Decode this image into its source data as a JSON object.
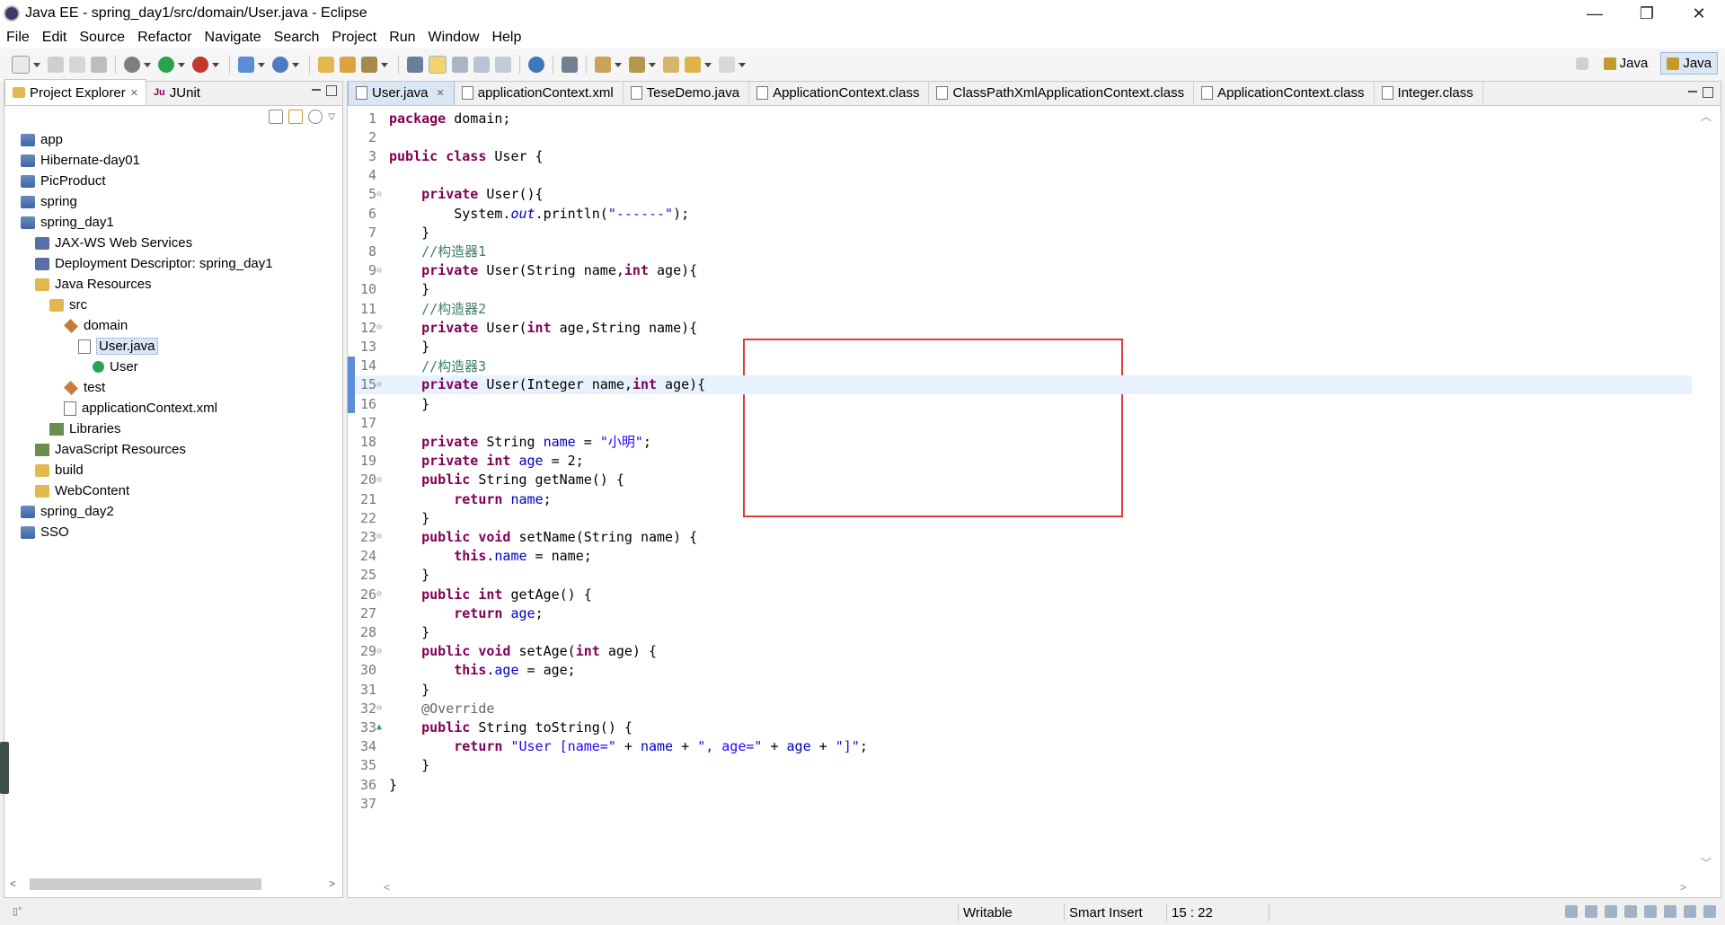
{
  "window": {
    "title": "Java EE - spring_day1/src/domain/User.java - Eclipse",
    "controls": [
      "—",
      "❐",
      "✕"
    ]
  },
  "menu": [
    "File",
    "Edit",
    "Source",
    "Refactor",
    "Navigate",
    "Search",
    "Project",
    "Run",
    "Window",
    "Help"
  ],
  "perspectives": [
    {
      "label": "Java",
      "active": false
    },
    {
      "label": "Java",
      "active": true
    }
  ],
  "project_explorer": {
    "tabs": [
      {
        "label": "Project Explorer",
        "active": true,
        "closable": true
      },
      {
        "label": "JUnit",
        "active": false,
        "closable": false
      }
    ],
    "tree": [
      {
        "label": "app",
        "indent": 0,
        "icon": "project-icon"
      },
      {
        "label": "Hibernate-day01",
        "indent": 0,
        "icon": "project-icon"
      },
      {
        "label": "PicProduct",
        "indent": 0,
        "icon": "project-icon"
      },
      {
        "label": "spring",
        "indent": 0,
        "icon": "project-icon"
      },
      {
        "label": "spring_day1",
        "indent": 0,
        "icon": "project-icon"
      },
      {
        "label": "JAX-WS Web Services",
        "indent": 1,
        "icon": "web-services-icon"
      },
      {
        "label": "Deployment Descriptor: spring_day1",
        "indent": 1,
        "icon": "descriptor-icon"
      },
      {
        "label": "Java Resources",
        "indent": 1,
        "icon": "java-resources-icon"
      },
      {
        "label": "src",
        "indent": 2,
        "icon": "source-folder-icon"
      },
      {
        "label": "domain",
        "indent": 3,
        "icon": "package-icon"
      },
      {
        "label": "User.java",
        "indent": 4,
        "icon": "java-file-icon",
        "selected": true
      },
      {
        "label": "User",
        "indent": 5,
        "icon": "class-icon"
      },
      {
        "label": "test",
        "indent": 3,
        "icon": "package-icon"
      },
      {
        "label": "applicationContext.xml",
        "indent": 3,
        "icon": "xml-file-icon"
      },
      {
        "label": "Libraries",
        "indent": 2,
        "icon": "libraries-icon"
      },
      {
        "label": "JavaScript Resources",
        "indent": 1,
        "icon": "js-resources-icon"
      },
      {
        "label": "build",
        "indent": 1,
        "icon": "folder-icon"
      },
      {
        "label": "WebContent",
        "indent": 1,
        "icon": "folder-icon"
      },
      {
        "label": "spring_day2",
        "indent": 0,
        "icon": "project-icon"
      },
      {
        "label": "SSO",
        "indent": 0,
        "icon": "project-icon"
      }
    ]
  },
  "editor": {
    "tabs": [
      {
        "label": "User.java",
        "active": true
      },
      {
        "label": "applicationContext.xml",
        "active": false
      },
      {
        "label": "TeseDemo.java",
        "active": false
      },
      {
        "label": "ApplicationContext.class",
        "active": false
      },
      {
        "label": "ClassPathXmlApplicationContext.class",
        "active": false
      },
      {
        "label": "ApplicationContext.class",
        "active": false
      },
      {
        "label": "Integer.class",
        "active": false
      }
    ],
    "current_line": 15,
    "lines": [
      {
        "n": "1",
        "fold": "",
        "code": [
          [
            "kw",
            "package"
          ],
          [
            "t",
            " domain;"
          ]
        ]
      },
      {
        "n": "2",
        "fold": "",
        "code": []
      },
      {
        "n": "3",
        "fold": "",
        "code": [
          [
            "kw",
            "public class"
          ],
          [
            "t",
            " User {"
          ]
        ]
      },
      {
        "n": "4",
        "fold": "",
        "code": []
      },
      {
        "n": "5",
        "fold": "⊖",
        "code": [
          [
            "t",
            "    "
          ],
          [
            "kw",
            "private"
          ],
          [
            "t",
            " User(){"
          ]
        ]
      },
      {
        "n": "6",
        "fold": "",
        "code": [
          [
            "t",
            "        System."
          ],
          [
            "stat",
            "out"
          ],
          [
            "t",
            ".println("
          ],
          [
            "str",
            "\"------\""
          ],
          [
            "t",
            ");"
          ]
        ]
      },
      {
        "n": "7",
        "fold": "",
        "code": [
          [
            "t",
            "    }"
          ]
        ]
      },
      {
        "n": "8",
        "fold": "",
        "code": [
          [
            "t",
            "    "
          ],
          [
            "cmt",
            "//构造器1"
          ]
        ]
      },
      {
        "n": "9",
        "fold": "⊖",
        "code": [
          [
            "t",
            "    "
          ],
          [
            "kw",
            "private"
          ],
          [
            "t",
            " User(String name,"
          ],
          [
            "kw",
            "int"
          ],
          [
            "t",
            " age){"
          ]
        ]
      },
      {
        "n": "10",
        "fold": "",
        "code": [
          [
            "t",
            "    }"
          ]
        ]
      },
      {
        "n": "11",
        "fold": "",
        "code": [
          [
            "t",
            "    "
          ],
          [
            "cmt",
            "//构造器2"
          ]
        ]
      },
      {
        "n": "12",
        "fold": "⊖",
        "code": [
          [
            "t",
            "    "
          ],
          [
            "kw",
            "private"
          ],
          [
            "t",
            " User("
          ],
          [
            "kw",
            "int"
          ],
          [
            "t",
            " age,String name){"
          ]
        ]
      },
      {
        "n": "13",
        "fold": "",
        "code": [
          [
            "t",
            "    }"
          ]
        ]
      },
      {
        "n": "14",
        "fold": "",
        "code": [
          [
            "t",
            "    "
          ],
          [
            "cmt",
            "//构造器3"
          ]
        ]
      },
      {
        "n": "15",
        "fold": "⊖",
        "code": [
          [
            "t",
            "    "
          ],
          [
            "kw",
            "private"
          ],
          [
            "t",
            " User(Integer name,"
          ],
          [
            "kw",
            "int"
          ],
          [
            "t",
            " age){"
          ]
        ]
      },
      {
        "n": "16",
        "fold": "",
        "code": [
          [
            "t",
            "    }"
          ]
        ]
      },
      {
        "n": "17",
        "fold": "",
        "code": []
      },
      {
        "n": "18",
        "fold": "",
        "code": [
          [
            "t",
            "    "
          ],
          [
            "kw",
            "private"
          ],
          [
            "t",
            " String "
          ],
          [
            "fld",
            "name"
          ],
          [
            "t",
            " = "
          ],
          [
            "str",
            "\"小明\""
          ],
          [
            "t",
            ";"
          ]
        ]
      },
      {
        "n": "19",
        "fold": "",
        "code": [
          [
            "t",
            "    "
          ],
          [
            "kw",
            "private int"
          ],
          [
            "t",
            " "
          ],
          [
            "fld",
            "age"
          ],
          [
            "t",
            " = 2;"
          ]
        ]
      },
      {
        "n": "20",
        "fold": "⊖",
        "code": [
          [
            "t",
            "    "
          ],
          [
            "kw",
            "public"
          ],
          [
            "t",
            " String getName() {"
          ]
        ]
      },
      {
        "n": "21",
        "fold": "",
        "code": [
          [
            "t",
            "        "
          ],
          [
            "kw",
            "return"
          ],
          [
            "t",
            " "
          ],
          [
            "fld",
            "name"
          ],
          [
            "t",
            ";"
          ]
        ]
      },
      {
        "n": "22",
        "fold": "",
        "code": [
          [
            "t",
            "    }"
          ]
        ]
      },
      {
        "n": "23",
        "fold": "⊖",
        "code": [
          [
            "t",
            "    "
          ],
          [
            "kw",
            "public void"
          ],
          [
            "t",
            " setName(String name) {"
          ]
        ]
      },
      {
        "n": "24",
        "fold": "",
        "code": [
          [
            "t",
            "        "
          ],
          [
            "kw",
            "this"
          ],
          [
            "t",
            "."
          ],
          [
            "fld",
            "name"
          ],
          [
            "t",
            " = name;"
          ]
        ]
      },
      {
        "n": "25",
        "fold": "",
        "code": [
          [
            "t",
            "    }"
          ]
        ]
      },
      {
        "n": "26",
        "fold": "⊖",
        "code": [
          [
            "t",
            "    "
          ],
          [
            "kw",
            "public int"
          ],
          [
            "t",
            " getAge() {"
          ]
        ]
      },
      {
        "n": "27",
        "fold": "",
        "code": [
          [
            "t",
            "        "
          ],
          [
            "kw",
            "return"
          ],
          [
            "t",
            " "
          ],
          [
            "fld",
            "age"
          ],
          [
            "t",
            ";"
          ]
        ]
      },
      {
        "n": "28",
        "fold": "",
        "code": [
          [
            "t",
            "    }"
          ]
        ]
      },
      {
        "n": "29",
        "fold": "⊖",
        "code": [
          [
            "t",
            "    "
          ],
          [
            "kw",
            "public void"
          ],
          [
            "t",
            " setAge("
          ],
          [
            "kw",
            "int"
          ],
          [
            "t",
            " age) {"
          ]
        ]
      },
      {
        "n": "30",
        "fold": "",
        "code": [
          [
            "t",
            "        "
          ],
          [
            "kw",
            "this"
          ],
          [
            "t",
            "."
          ],
          [
            "fld",
            "age"
          ],
          [
            "t",
            " = age;"
          ]
        ]
      },
      {
        "n": "31",
        "fold": "",
        "code": [
          [
            "t",
            "    }"
          ]
        ]
      },
      {
        "n": "32",
        "fold": "⊖",
        "code": [
          [
            "t",
            "    "
          ],
          [
            "ann",
            "@Override"
          ]
        ]
      },
      {
        "n": "33",
        "fold": "▲",
        "code": [
          [
            "t",
            "    "
          ],
          [
            "kw",
            "public"
          ],
          [
            "t",
            " String toString() {"
          ]
        ]
      },
      {
        "n": "34",
        "fold": "",
        "code": [
          [
            "t",
            "        "
          ],
          [
            "kw",
            "return"
          ],
          [
            "t",
            " "
          ],
          [
            "str",
            "\"User [name=\""
          ],
          [
            "t",
            " + "
          ],
          [
            "fld",
            "name"
          ],
          [
            "t",
            " + "
          ],
          [
            "str",
            "\", age=\""
          ],
          [
            "t",
            " + "
          ],
          [
            "fld",
            "age"
          ],
          [
            "t",
            " + "
          ],
          [
            "str",
            "\"]\""
          ],
          [
            "t",
            ";"
          ]
        ]
      },
      {
        "n": "35",
        "fold": "",
        "code": [
          [
            "t",
            "    }"
          ]
        ]
      },
      {
        "n": "36",
        "fold": "",
        "code": [
          [
            "t",
            "}"
          ]
        ]
      },
      {
        "n": "37",
        "fold": "",
        "code": []
      }
    ]
  },
  "status": {
    "writable": "Writable",
    "insert_mode": "Smart Insert",
    "position": "15 : 22"
  },
  "colors": {
    "keyword": "#7f0055",
    "string": "#2a00ff",
    "field": "#0000c0",
    "comment": "#3f7f5f",
    "highlight_box": "#e03a3a",
    "current_line": "#e8f2fe"
  }
}
